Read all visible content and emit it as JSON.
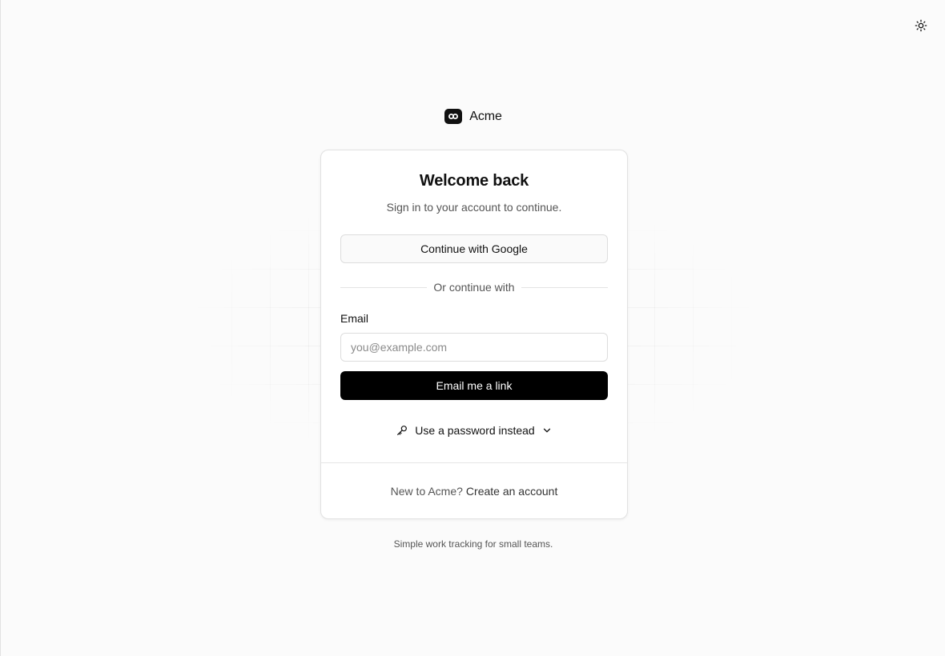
{
  "brand": {
    "name": "Acme",
    "logo_icon": "acme-logo-icon"
  },
  "header": {
    "theme_toggle_icon": "sun-icon"
  },
  "card": {
    "title": "Welcome back",
    "subtitle": "Sign in to your account to continue.",
    "google_button_label": "Continue with Google",
    "divider_text": "Or continue with",
    "email": {
      "label": "Email",
      "placeholder": "you@example.com",
      "value": ""
    },
    "submit_label": "Email me a link",
    "password_toggle": {
      "label": "Use a password instead",
      "icon": "key-icon",
      "chevron_icon": "chevron-down-icon"
    },
    "footer": {
      "prompt": "New to Acme?",
      "link_label": "Create an account"
    }
  },
  "tagline": "Simple work tracking for small teams.",
  "colors": {
    "background": "#fbfbfb",
    "card": "#ffffff",
    "primary_button": "#000000",
    "border": "#e2e2e2",
    "muted_text": "#555555"
  }
}
